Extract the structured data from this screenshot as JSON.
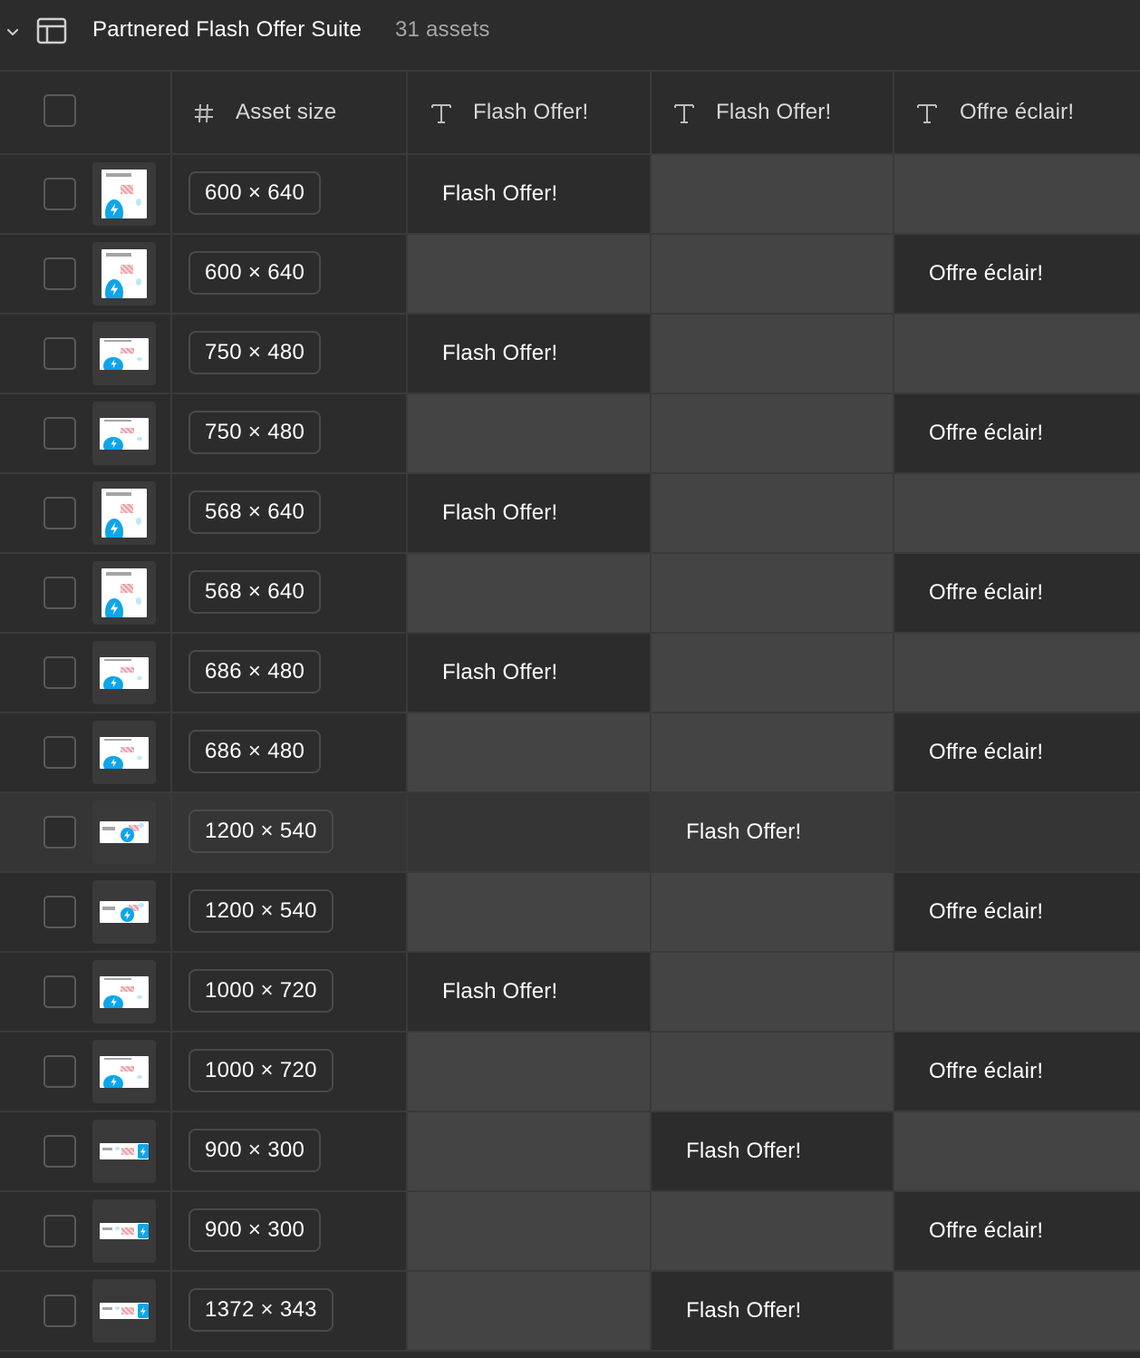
{
  "header": {
    "title": "Partnered Flash Offer Suite",
    "count": "31 assets"
  },
  "columns": [
    {
      "label": "Asset size",
      "icon": "hash-icon"
    },
    {
      "label": "Flash Offer!",
      "icon": "text-type-icon"
    },
    {
      "label": "Flash Offer!",
      "icon": "text-type-icon"
    },
    {
      "label": "Offre éclair!",
      "icon": "text-type-icon"
    }
  ],
  "rows": [
    {
      "size": "600 × 640",
      "col": 1,
      "text": "Flash Offer!",
      "thumb": "portrait"
    },
    {
      "size": "600 × 640",
      "col": 3,
      "text": "Offre éclair!",
      "thumb": "portrait"
    },
    {
      "size": "750 × 480",
      "col": 1,
      "text": "Flash Offer!",
      "thumb": "landscape"
    },
    {
      "size": "750 × 480",
      "col": 3,
      "text": "Offre éclair!",
      "thumb": "landscape"
    },
    {
      "size": "568 × 640",
      "col": 1,
      "text": "Flash Offer!",
      "thumb": "portrait"
    },
    {
      "size": "568 × 640",
      "col": 3,
      "text": "Offre éclair!",
      "thumb": "portrait"
    },
    {
      "size": "686 × 480",
      "col": 1,
      "text": "Flash Offer!",
      "thumb": "landscape"
    },
    {
      "size": "686 × 480",
      "col": 3,
      "text": "Offre éclair!",
      "thumb": "landscape"
    },
    {
      "size": "1200 × 540",
      "col": 2,
      "text": "Flash Offer!",
      "thumb": "wide",
      "highlight": true
    },
    {
      "size": "1200 × 540",
      "col": 3,
      "text": "Offre éclair!",
      "thumb": "wide"
    },
    {
      "size": "1000 × 720",
      "col": 1,
      "text": "Flash Offer!",
      "thumb": "landscape"
    },
    {
      "size": "1000 × 720",
      "col": 3,
      "text": "Offre éclair!",
      "thumb": "landscape"
    },
    {
      "size": "900 × 300",
      "col": 2,
      "text": "Flash Offer!",
      "thumb": "banner"
    },
    {
      "size": "900 × 300",
      "col": 3,
      "text": "Offre éclair!",
      "thumb": "banner"
    },
    {
      "size": "1372 × 343",
      "col": 2,
      "text": "Flash Offer!",
      "thumb": "banner"
    }
  ],
  "colors": {
    "background": "#2c2c2c",
    "empty_cell": "#444444",
    "accent_blue": "#0ea5e9"
  }
}
